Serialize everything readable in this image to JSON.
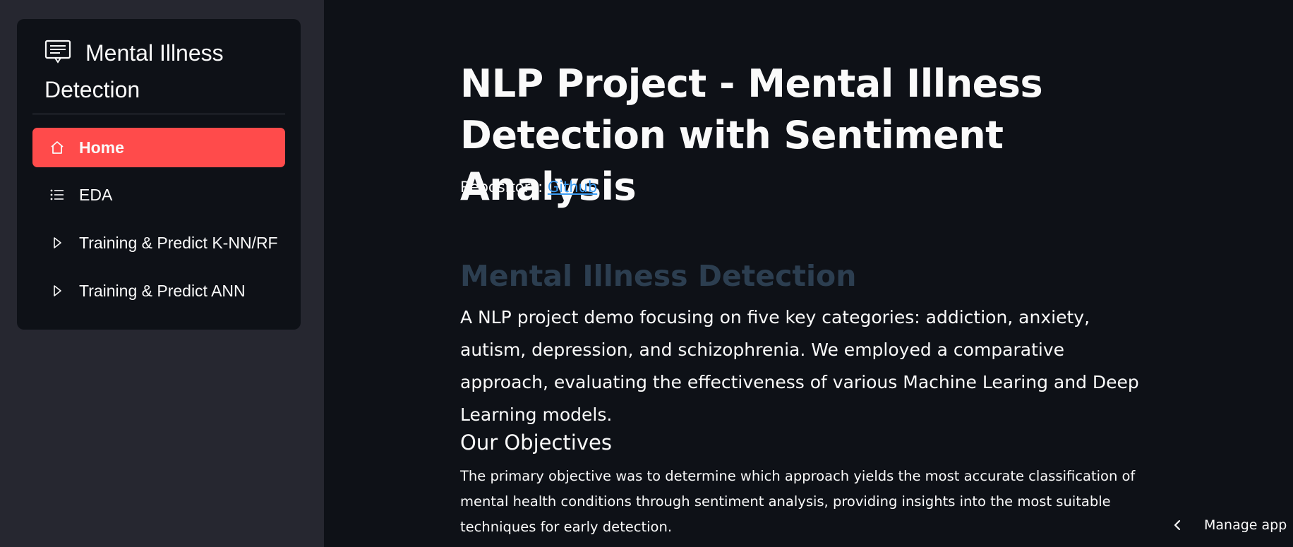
{
  "sidebar": {
    "title": "Mental Illness Detection",
    "items": [
      {
        "label": "Home",
        "icon": "house-icon",
        "active": true
      },
      {
        "label": "EDA",
        "icon": "list-icon",
        "active": false
      },
      {
        "label": "Training & Predict K-NN/RF",
        "icon": "play-icon",
        "active": false
      },
      {
        "label": "Training & Predict ANN",
        "icon": "play-icon",
        "active": false
      }
    ]
  },
  "main": {
    "title": "NLP Project - Mental Illness Detection with Sentiment Analysis",
    "repo_label": "Repository: ",
    "repo_link": "Github",
    "section_title": "Mental Illness Detection",
    "lead": "A NLP project demo focusing on five key categories: addiction, anxiety, autism, depression, and schizophrenia. We employed a comparative approach, evaluating the effectiveness of various Machine Learing and Deep Learning models.",
    "objectives_title": "Our Objectives",
    "objectives_text": "The primary objective was to determine which approach yields the most accurate classification of mental health conditions through sentiment analysis, providing insights into the most suitable techniques for early detection."
  },
  "footer": {
    "manage_label": "Manage app"
  },
  "colors": {
    "accent": "#ff4b4b",
    "link": "#3d9df3",
    "background": "#0e1117",
    "sidebar": "#262730",
    "section_title": "#2c3e50"
  }
}
